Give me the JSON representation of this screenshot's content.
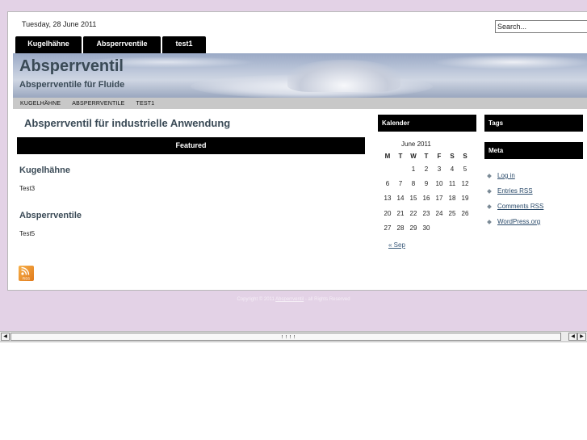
{
  "header": {
    "date": "Tuesday, 28 June 2011",
    "search_value": "Search..."
  },
  "tabs": [
    {
      "label": "Kugelhähne"
    },
    {
      "label": "Absperrventile"
    },
    {
      "label": "test1"
    }
  ],
  "site": {
    "title": "Absperrventil",
    "tagline": "Absperrventile für Fluide"
  },
  "subnav": [
    "KUGELHÄHNE",
    "ABSPERRVENTILE",
    "TEST1"
  ],
  "main": {
    "post_title": "Absperrventil für industrielle Anwendung",
    "featured_label": "Featured",
    "categories": [
      {
        "title": "Kugelhähne",
        "text": "Test3"
      },
      {
        "title": "Absperrventile",
        "text": "Test5"
      }
    ],
    "rss_text": "RSS"
  },
  "sidebar": {
    "calendar_heading": "Kalender",
    "calendar_caption": "June 2011",
    "weekdays": [
      "M",
      "T",
      "W",
      "T",
      "F",
      "S",
      "S"
    ],
    "weeks": [
      [
        "",
        "",
        "1",
        "2",
        "3",
        "4",
        "5"
      ],
      [
        "6",
        "7",
        "8",
        "9",
        "10",
        "11",
        "12"
      ],
      [
        "13",
        "14",
        "15",
        "16",
        "17",
        "18",
        "19"
      ],
      [
        "20",
        "21",
        "22",
        "23",
        "24",
        "25",
        "26"
      ],
      [
        "27",
        "28",
        "29",
        "30",
        "",
        "",
        ""
      ]
    ],
    "prev_month": "« Sep",
    "tags_heading": "Tags",
    "meta_heading": "Meta",
    "meta_links": [
      "Log in",
      "Entries RSS",
      "Comments RSS",
      "WordPress.org"
    ]
  },
  "footer": {
    "prefix": "Copyright © 2011",
    "link": "Absperrventil",
    "suffix": "- all Rights Reserved"
  },
  "colors": {
    "page_background": "#e3d2e6",
    "nav_black": "#000000",
    "title_slate": "#3a4a56",
    "link_blue": "#2a4a6a"
  }
}
